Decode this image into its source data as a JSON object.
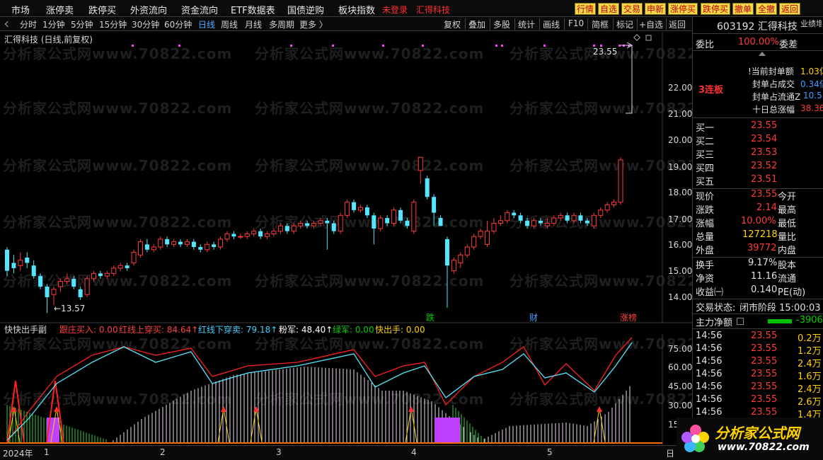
{
  "menu": {
    "items": [
      "市场",
      "涨停卖",
      "跌停买",
      "外资流向",
      "资金流向",
      "ETF数据表",
      "国债逆购",
      "板块指数"
    ],
    "login": "未登录",
    "stock_tag": "汇得科技"
  },
  "quick_buttons": [
    "行情",
    "自选",
    "交易",
    "申新",
    "涨停买",
    "跌停买",
    "撤单",
    "全撤",
    "返回"
  ],
  "toolbar": {
    "periods": [
      "分时",
      "1分钟",
      "5分钟",
      "15分钟",
      "30分钟",
      "60分钟",
      "日线",
      "周线",
      "月线",
      "多周期",
      "更多 〉"
    ],
    "active": "日线",
    "tools": [
      "复权",
      "叠加",
      "多股",
      "统计",
      "画线",
      "F10",
      "简框",
      "标记",
      "+自选",
      "返回"
    ]
  },
  "chart": {
    "title": "汇得科技 (日线,前复权)",
    "price_labels": [
      "22.00",
      "21.00",
      "20.00",
      "19.00",
      "18.00",
      "17.00",
      "16.00",
      "15.00",
      "14.00"
    ],
    "high_label": "23.55",
    "low_label": "←13.57",
    "event_markers": [
      {
        "text": "跌",
        "color": "#00d000"
      },
      {
        "text": "财",
        "color": "#40a0ff"
      },
      {
        "text": "涨榜",
        "color": "#ff4040"
      }
    ],
    "watermark": "分析家公式网www.70822.com"
  },
  "indicator": {
    "name": "快快出手副",
    "items": [
      {
        "text": "跟庄买入: 0.00",
        "color": "#ff4040"
      },
      {
        "text": "红线上穿买: 84.64↑",
        "color": "#ff4040"
      },
      {
        "text": "红线下穿卖: 79.18↑",
        "color": "#40d0ff"
      },
      {
        "text": "粉军: 48.40↑",
        "color": "#ffffff"
      },
      {
        "text": "绿军: 0.00",
        "color": "#00d000"
      },
      {
        "text": "快出手: 0.00",
        "color": "#ffd200"
      }
    ],
    "axis_labels": [
      "75.00",
      "60.00",
      "45.00",
      "30.00",
      "15"
    ]
  },
  "xaxis": {
    "labels": [
      "2024年",
      "1",
      "2",
      "3",
      "4",
      "5"
    ],
    "right": "日"
  },
  "quote": {
    "code_name": "603192 汇得科技",
    "side_note": "业绩增",
    "weibi_label": "委比",
    "weibi_value": "100.00%",
    "weicha_label": "委差",
    "lianban": "3连板",
    "seal_rows": [
      {
        "label": "!当前封单额",
        "value": "1.03亿"
      },
      {
        "label": "封单占成交",
        "value": "0.34倍"
      },
      {
        "label": "封单占流通Z",
        "value": "10.5"
      },
      {
        "label": "十日总涨幅",
        "value": "38.36"
      }
    ],
    "bids": [
      {
        "label": "买一",
        "price": "23.55"
      },
      {
        "label": "买二",
        "price": "23.54"
      },
      {
        "label": "买三",
        "price": "23.53"
      },
      {
        "label": "买四",
        "price": "23.52"
      },
      {
        "label": "买五",
        "price": "23.51"
      }
    ],
    "stats": [
      {
        "l1": "现价",
        "v1": "23.55",
        "c1": "red",
        "l2": "今开"
      },
      {
        "l1": "涨跌",
        "v1": "2.14",
        "c1": "red",
        "l2": "最高"
      },
      {
        "l1": "涨幅",
        "v1": "10.00%",
        "c1": "red",
        "l2": "最低"
      },
      {
        "l1": "总量",
        "v1": "127218",
        "c1": "yellow",
        "l2": "量比"
      },
      {
        "l1": "外盘",
        "v1": "39772",
        "c1": "red",
        "l2": "内盘"
      }
    ],
    "stats2": [
      {
        "l1": "换手",
        "v1": "9.17%",
        "l2": "股本"
      },
      {
        "l1": "净资",
        "v1": "11.16",
        "l2": "流通"
      },
      {
        "l1": "收益㈠",
        "v1": "0.140",
        "l2": "PE(动)"
      }
    ],
    "status_label": "交易状态:",
    "status_value": "闭市阶段 15:00:03",
    "main_flow_label": "主力净额",
    "main_flow_value": "-3906",
    "ticks": [
      {
        "time": "14:56",
        "price": "23.55",
        "vol": "0.2万"
      },
      {
        "time": "14:56",
        "price": "23.55",
        "vol": "1.2万"
      },
      {
        "time": "14:56",
        "price": "23.55",
        "vol": "2.4万"
      },
      {
        "time": "14:56",
        "price": "23.55",
        "vol": "1.6万"
      },
      {
        "time": "14:56",
        "price": "23.55",
        "vol": "2.4万"
      },
      {
        "time": "14:56",
        "price": "23.55",
        "vol": "2.6万"
      },
      {
        "time": "14:56",
        "price": "23.55",
        "vol": "1.4万"
      }
    ]
  },
  "logo": {
    "text": "分析家公式网",
    "url": "www.70822.com"
  },
  "chart_data": {
    "type": "candlestick",
    "title": "汇得科技 (日线,前复权)",
    "ylim": [
      13.5,
      24.0
    ],
    "candles": [
      [
        16.0,
        15.2,
        16.1,
        15.0
      ],
      [
        15.5,
        15.3,
        15.8,
        15.1
      ],
      [
        15.4,
        15.6,
        15.9,
        15.2
      ],
      [
        15.7,
        15.5,
        15.9,
        15.3
      ],
      [
        15.4,
        15.0,
        15.6,
        14.9
      ],
      [
        15.0,
        14.6,
        15.1,
        14.5
      ],
      [
        14.6,
        14.2,
        14.7,
        13.6
      ],
      [
        14.3,
        14.5,
        14.6,
        13.9
      ],
      [
        14.6,
        14.8,
        14.9,
        14.4
      ],
      [
        14.8,
        14.9,
        15.1,
        14.7
      ],
      [
        14.9,
        14.6,
        15.0,
        14.5
      ],
      [
        14.5,
        14.2,
        14.6,
        14.1
      ],
      [
        14.3,
        14.9,
        15.0,
        14.2
      ],
      [
        14.9,
        15.1,
        15.2,
        14.8
      ],
      [
        15.1,
        15.0,
        15.2,
        14.9
      ],
      [
        15.0,
        15.1,
        15.2,
        14.9
      ],
      [
        15.1,
        15.3,
        15.4,
        15.0
      ],
      [
        15.3,
        15.4,
        15.5,
        15.2
      ],
      [
        15.4,
        15.3,
        15.5,
        15.2
      ],
      [
        15.5,
        15.9,
        16.0,
        15.4
      ],
      [
        15.8,
        16.3,
        16.4,
        15.7
      ],
      [
        16.2,
        16.0,
        16.4,
        15.9
      ],
      [
        16.0,
        16.1,
        16.2,
        15.9
      ],
      [
        16.1,
        16.4,
        16.5,
        16.0
      ],
      [
        16.4,
        16.2,
        16.5,
        16.1
      ],
      [
        16.2,
        16.3,
        16.4,
        16.1
      ],
      [
        16.3,
        16.2,
        16.4,
        16.1
      ],
      [
        16.2,
        16.3,
        16.4,
        16.1
      ],
      [
        16.3,
        16.1,
        16.4,
        16.0
      ],
      [
        16.1,
        16.0,
        16.2,
        15.9
      ],
      [
        16.0,
        16.2,
        16.3,
        15.9
      ],
      [
        16.2,
        16.1,
        16.3,
        16.0
      ],
      [
        16.1,
        16.4,
        16.5,
        16.0
      ],
      [
        16.4,
        16.6,
        16.7,
        16.3
      ],
      [
        16.6,
        16.5,
        16.7,
        16.4
      ],
      [
        16.5,
        16.5,
        16.6,
        16.4
      ],
      [
        16.5,
        16.6,
        16.7,
        16.4
      ],
      [
        16.6,
        16.7,
        16.8,
        16.5
      ],
      [
        16.7,
        16.5,
        16.8,
        16.4
      ],
      [
        16.5,
        16.6,
        16.7,
        16.4
      ],
      [
        16.6,
        16.7,
        16.8,
        16.5
      ],
      [
        16.7,
        16.9,
        17.0,
        16.6
      ],
      [
        16.9,
        16.7,
        17.0,
        16.6
      ],
      [
        16.7,
        16.9,
        17.0,
        16.6
      ],
      [
        16.9,
        17.0,
        17.1,
        16.8
      ],
      [
        17.0,
        16.9,
        17.1,
        16.8
      ],
      [
        16.9,
        17.0,
        17.1,
        16.8
      ],
      [
        17.0,
        17.1,
        17.2,
        16.9
      ],
      [
        17.1,
        17.0,
        17.2,
        16.0
      ],
      [
        17.0,
        16.7,
        17.1,
        16.6
      ],
      [
        16.7,
        17.3,
        17.4,
        16.6
      ],
      [
        17.3,
        17.8,
        17.9,
        17.2
      ],
      [
        17.8,
        17.5,
        17.9,
        17.4
      ],
      [
        17.5,
        17.6,
        17.7,
        17.4
      ],
      [
        17.6,
        17.3,
        17.7,
        17.2
      ],
      [
        17.3,
        16.8,
        17.4,
        16.2
      ],
      [
        16.8,
        17.2,
        17.3,
        16.7
      ],
      [
        17.2,
        17.0,
        17.3,
        16.9
      ],
      [
        17.0,
        17.5,
        17.6,
        16.9
      ],
      [
        17.5,
        17.1,
        17.6,
        17.0
      ],
      [
        17.1,
        16.9,
        17.2,
        16.8
      ],
      [
        16.7,
        17.8,
        17.9,
        16.6
      ],
      [
        19.0,
        19.5,
        19.5,
        18.5
      ],
      [
        18.7,
        18.0,
        18.8,
        17.9
      ],
      [
        18.0,
        17.4,
        18.1,
        16.9
      ],
      [
        17.2,
        16.9,
        17.3,
        16.9
      ],
      [
        16.4,
        15.4,
        16.5,
        13.8
      ],
      [
        15.2,
        15.6,
        15.7,
        15.1
      ],
      [
        15.5,
        15.8,
        15.9,
        15.3
      ],
      [
        15.8,
        16.1,
        16.2,
        15.7
      ],
      [
        16.1,
        16.5,
        16.6,
        16.0
      ],
      [
        16.5,
        16.7,
        16.8,
        16.4
      ],
      [
        16.2,
        16.7,
        17.1,
        16.1
      ],
      [
        16.7,
        17.0,
        17.2,
        16.6
      ],
      [
        17.0,
        17.1,
        17.3,
        16.9
      ],
      [
        17.1,
        17.4,
        17.5,
        17.0
      ],
      [
        17.4,
        17.3,
        17.5,
        17.2
      ],
      [
        17.3,
        17.1,
        17.4,
        17.0
      ],
      [
        17.1,
        16.9,
        17.2,
        16.8
      ],
      [
        16.9,
        17.1,
        17.2,
        16.8
      ],
      [
        17.1,
        17.0,
        17.2,
        16.9
      ],
      [
        16.9,
        17.0,
        17.2,
        16.8
      ],
      [
        17.0,
        17.2,
        17.3,
        16.9
      ],
      [
        17.2,
        17.3,
        17.4,
        17.1
      ],
      [
        17.3,
        17.1,
        17.4,
        17.0
      ],
      [
        17.1,
        17.3,
        17.4,
        17.0
      ],
      [
        17.3,
        17.1,
        17.4,
        17.0
      ],
      [
        17.1,
        17.0,
        17.2,
        16.9
      ],
      [
        16.9,
        17.3,
        17.4,
        16.8
      ],
      [
        17.3,
        17.5,
        17.6,
        17.2
      ],
      [
        17.5,
        17.7,
        17.8,
        17.4
      ],
      [
        17.7,
        17.8,
        17.9,
        17.6
      ],
      [
        17.8,
        19.4,
        19.5,
        17.7
      ]
    ]
  }
}
